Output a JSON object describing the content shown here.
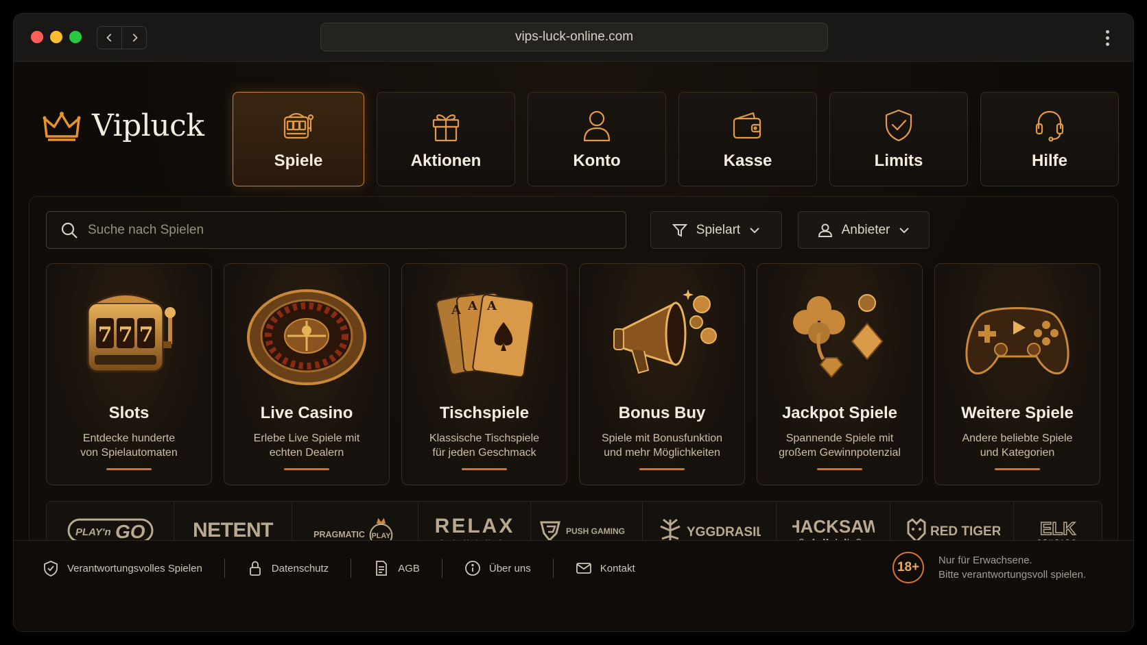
{
  "browser": {
    "url": "vips-luck-online.com"
  },
  "brand": {
    "name": "Vipluck",
    "icon": "crown-icon"
  },
  "nav": {
    "items": [
      {
        "label": "Spiele",
        "icon": "slot-machine-icon",
        "active": true
      },
      {
        "label": "Aktionen",
        "icon": "gift-icon",
        "active": false
      },
      {
        "label": "Konto",
        "icon": "user-icon",
        "active": false
      },
      {
        "label": "Kasse",
        "icon": "wallet-icon",
        "active": false
      },
      {
        "label": "Limits",
        "icon": "shield-check-icon",
        "active": false
      },
      {
        "label": "Hilfe",
        "icon": "headset-icon",
        "active": false
      }
    ]
  },
  "search": {
    "placeholder": "Suche nach Spielen",
    "value": ""
  },
  "filters": {
    "type_label": "Spielart",
    "provider_label": "Anbieter"
  },
  "games": [
    {
      "title": "Slots",
      "desc_1": "Entdecke hunderte",
      "desc_2": "von Spielautomaten"
    },
    {
      "title": "Live Casino",
      "desc_1": "Erlebe Live Spiele mit",
      "desc_2": "echten Dealern"
    },
    {
      "title": "Tischspiele",
      "desc_1": "Klassische Tischspiele",
      "desc_2": "für jeden Geschmack"
    },
    {
      "title": "Bonus Buy",
      "desc_1": "Spiele mit Bonusfunktion",
      "desc_2": "und mehr Möglichkeiten"
    },
    {
      "title": "Jackpot Spiele",
      "desc_1": "Spannende Spiele mit",
      "desc_2": "großem Gewinnpotenzial"
    },
    {
      "title": "Weitere Spiele",
      "desc_1": "Andere beliebte Spiele",
      "desc_2": "und Kategorien"
    }
  ],
  "providers": [
    "PLAY'n GO",
    "NETENT",
    "PRAGMATIC PLAY",
    "RELAX GAMING",
    "PUSH GAMING",
    "YGGDRASIL",
    "HACKSAW GAMING",
    "RED TIGER",
    "ELK STUDIOS"
  ],
  "footer": {
    "links": [
      "Verantwortungsvolles Spielen",
      "Datenschutz",
      "AGB",
      "Über uns",
      "Kontakt"
    ],
    "age_badge": "18+",
    "age_line1": "Nur für Erwachsene.",
    "age_line2": "Bitte verantwortungsvoll spielen."
  },
  "colors": {
    "accent": "#d9732a",
    "gold": "#e29a4a",
    "background": "#0f0c09"
  }
}
